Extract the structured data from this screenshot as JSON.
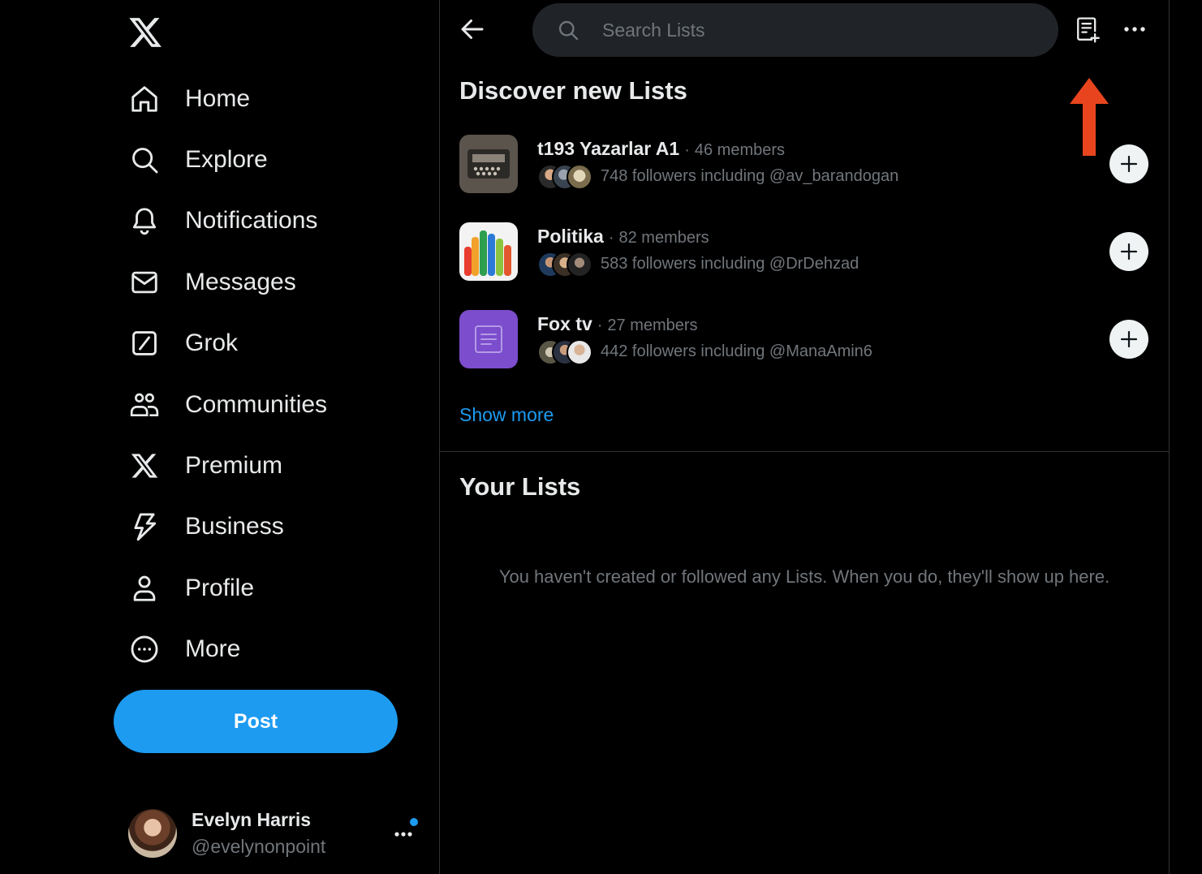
{
  "nav": {
    "items": [
      {
        "label": "Home",
        "icon": "home-icon"
      },
      {
        "label": "Explore",
        "icon": "search-icon"
      },
      {
        "label": "Notifications",
        "icon": "bell-icon"
      },
      {
        "label": "Messages",
        "icon": "envelope-icon"
      },
      {
        "label": "Grok",
        "icon": "grok-icon"
      },
      {
        "label": "Communities",
        "icon": "people-icon"
      },
      {
        "label": "Premium",
        "icon": "x-logo-icon"
      },
      {
        "label": "Business",
        "icon": "lightning-icon"
      },
      {
        "label": "Profile",
        "icon": "person-icon"
      },
      {
        "label": "More",
        "icon": "more-circle-icon"
      }
    ],
    "post_label": "Post"
  },
  "account": {
    "display_name": "Evelyn Harris",
    "handle": "@evelynonpoint"
  },
  "header": {
    "search_placeholder": "Search Lists"
  },
  "discover": {
    "title": "Discover new Lists",
    "lists": [
      {
        "name": "t193 Yazarlar A1",
        "separator": "·",
        "members": "46 members",
        "followers": "748 followers including @av_barandogan"
      },
      {
        "name": "Politika",
        "separator": "·",
        "members": "82 members",
        "followers": "583 followers including @DrDehzad"
      },
      {
        "name": "Fox tv",
        "separator": "·",
        "members": "27 members",
        "followers": "442 followers including @ManaAmin6"
      }
    ],
    "show_more": "Show more"
  },
  "your_lists": {
    "title": "Your Lists",
    "empty_message": "You haven't created or followed any Lists. When you do, they'll show up here."
  },
  "colors": {
    "accent": "#1d9bf0",
    "annotation_arrow": "#e8451e",
    "fox_tv_thumb": "#7c4dcc"
  }
}
